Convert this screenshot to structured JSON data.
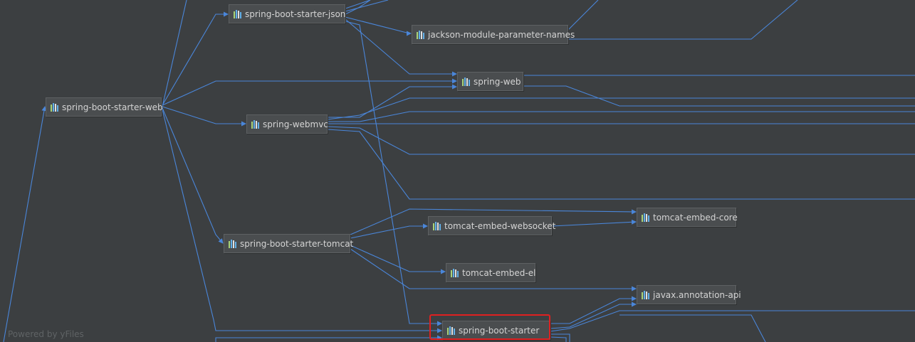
{
  "diagram": {
    "nodes": [
      {
        "id": "starter-web",
        "label": "spring-boot-starter-web"
      },
      {
        "id": "starter-json",
        "label": "spring-boot-starter-json"
      },
      {
        "id": "jackson-param",
        "label": "jackson-module-parameter-names"
      },
      {
        "id": "spring-web",
        "label": "spring-web"
      },
      {
        "id": "spring-webmvc",
        "label": "spring-webmvc"
      },
      {
        "id": "tomcat-core",
        "label": "tomcat-embed-core"
      },
      {
        "id": "tomcat-websocket",
        "label": "tomcat-embed-websocket"
      },
      {
        "id": "starter-tomcat",
        "label": "spring-boot-starter-tomcat"
      },
      {
        "id": "tomcat-el",
        "label": "tomcat-embed-el"
      },
      {
        "id": "javax-annotation",
        "label": "javax.annotation-api"
      },
      {
        "id": "boot-starter",
        "label": "spring-boot-starter",
        "highlighted": true
      }
    ],
    "edges": [
      {
        "from": "starter-web",
        "to": "starter-json"
      },
      {
        "from": "starter-web",
        "to": "spring-web"
      },
      {
        "from": "starter-web",
        "to": "spring-webmvc"
      },
      {
        "from": "starter-web",
        "to": "starter-tomcat"
      },
      {
        "from": "starter-web",
        "to": "boot-starter"
      },
      {
        "from": "starter-json",
        "to": "jackson-param"
      },
      {
        "from": "starter-json",
        "to": "spring-web"
      },
      {
        "from": "starter-json",
        "to": "boot-starter"
      },
      {
        "from": "spring-webmvc",
        "to": "spring-web"
      },
      {
        "from": "starter-tomcat",
        "to": "tomcat-core"
      },
      {
        "from": "starter-tomcat",
        "to": "tomcat-websocket"
      },
      {
        "from": "starter-tomcat",
        "to": "tomcat-el"
      },
      {
        "from": "starter-tomcat",
        "to": "javax-annotation"
      },
      {
        "from": "tomcat-websocket",
        "to": "tomcat-core"
      },
      {
        "from": "boot-starter",
        "to": "javax-annotation"
      }
    ],
    "accent_color": "#4a86d9",
    "highlight_color": "#e02020",
    "node_icon": "maven-library-icon"
  },
  "watermark": "Powered by yFiles"
}
